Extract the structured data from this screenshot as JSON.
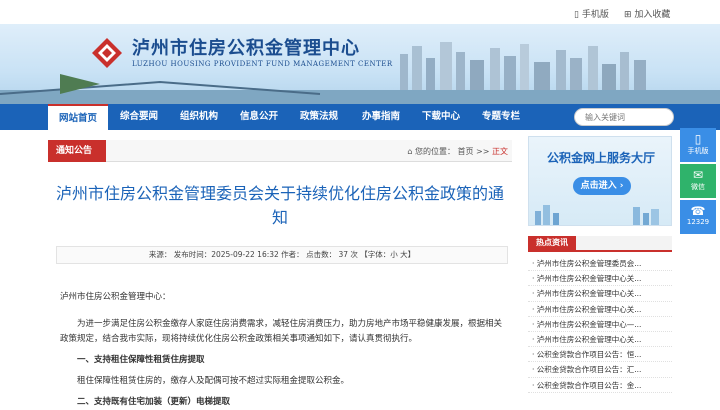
{
  "topbar": {
    "mobile": "手机版",
    "favorite": "加入收藏"
  },
  "header": {
    "title": "泸州市住房公积金管理中心",
    "subtitle": "LUZHOU HOUSING PROVIDENT FUND MANAGEMENT CENTER"
  },
  "nav": {
    "items": [
      "网站首页",
      "综合要闻",
      "组织机构",
      "信息公开",
      "政策法规",
      "办事指南",
      "下载中心",
      "专题专栏"
    ]
  },
  "search": {
    "placeholder": "输入关键词"
  },
  "sidetools": {
    "mobile": "手机版",
    "wechat": "微信",
    "hotline": "12329"
  },
  "breadcrumb": {
    "tab": "通知公告",
    "location": "您的位置：",
    "home": "首页",
    "sep1": ">>",
    "current": "正文"
  },
  "article": {
    "title": "泸州市住房公积金管理委员会关于持续优化住房公积金政策的通知",
    "meta": "来源：   发布时间：2025-09-22 16:32  作者：        点击数：  37  次    【字体：小 大】",
    "paragraphs": [
      "泸州市住房公积金管理中心：",
      "为进一步满足住房公积金缴存人家庭住房消费需求，减轻住房消费压力，助力房地产市场平稳健康发展，根据相关政策规定，结合我市实际，现将持续优化住房公积金政策相关事项通知如下，请认真贯彻执行。",
      "一、支持租住保障性租赁住房提取",
      "租住保障性租赁住房的，缴存人及配偶可按不超过实际租金提取公积金。",
      "二、支持既有住宅加装（更新）电梯提取"
    ]
  },
  "promo": {
    "title": "公积金网上服务大厅",
    "button": "点击进入 ›"
  },
  "hotnews": {
    "head": "热点资讯",
    "items": [
      "泸州市住房公积金管理委员会...",
      "泸州市住房公积金管理中心关...",
      "泸州市住房公积金管理中心关...",
      "泸州市住房公积金管理中心关...",
      "泸州市住房公积金管理中心—...",
      "泸州市住房公积金管理中心关...",
      "公积金贷款合作项目公告：恒...",
      "公积金贷款合作项目公告：汇...",
      "公积金贷款合作项目公告：金..."
    ]
  },
  "colors": {
    "brand": "#1b63b8",
    "accent": "#c9302c"
  }
}
